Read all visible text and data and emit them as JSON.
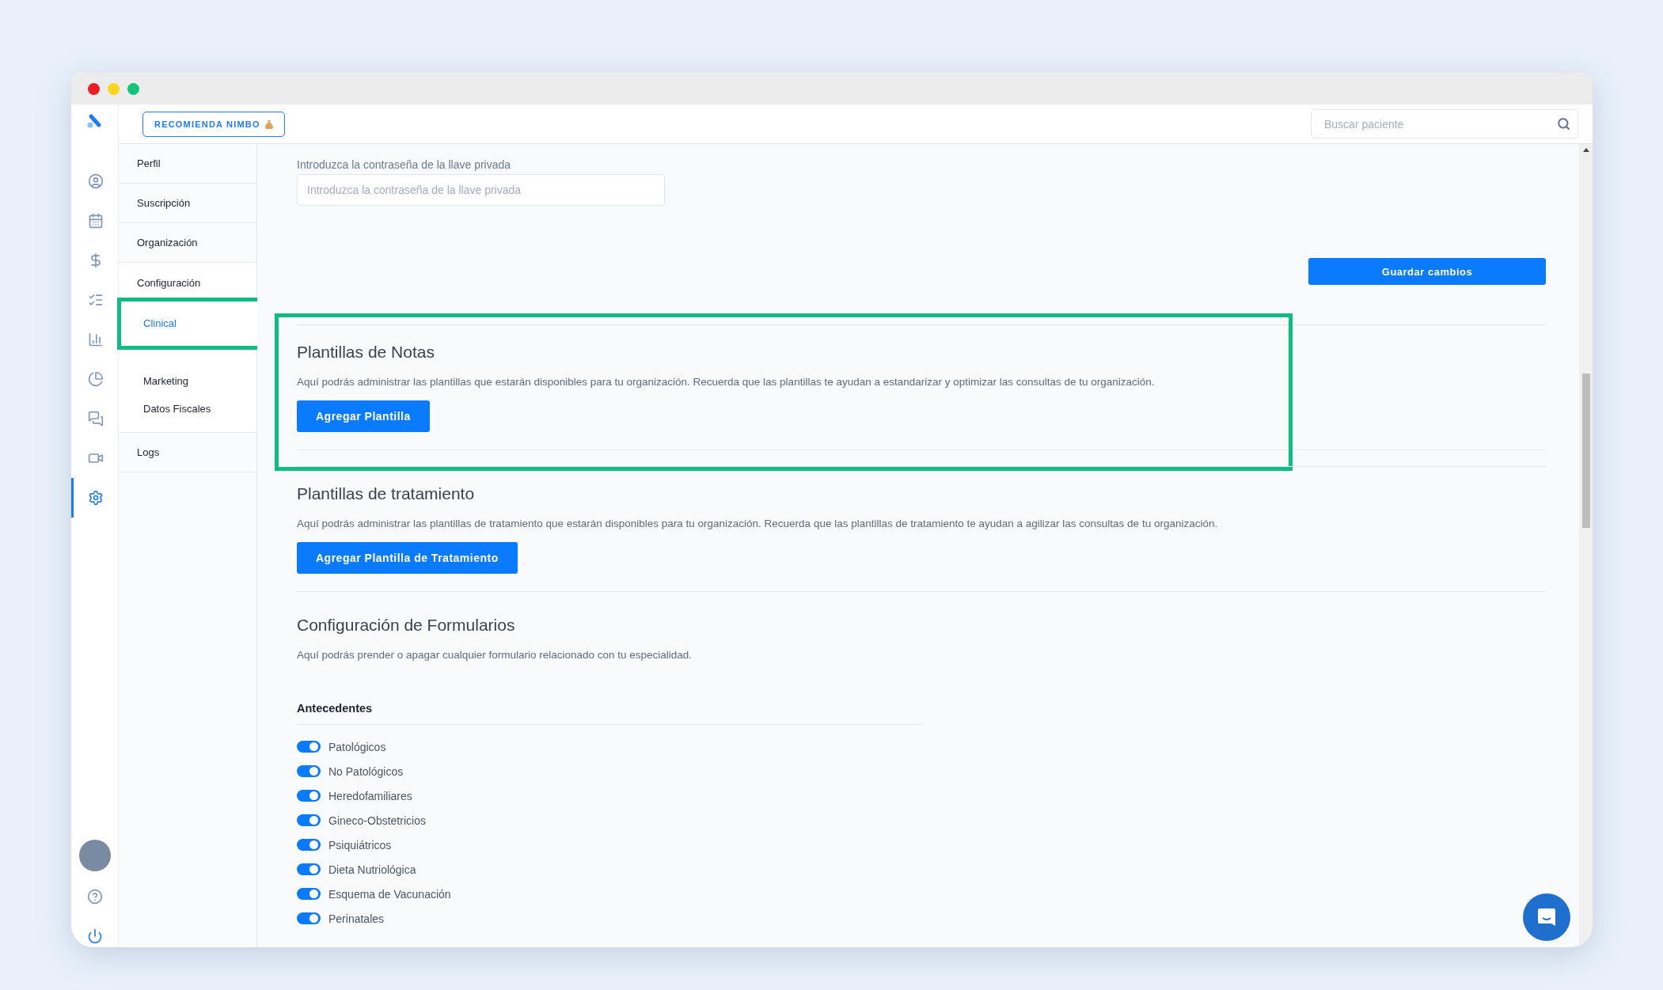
{
  "topbar": {
    "referral_button": "RECOMIENDA NIMBO",
    "search": {
      "placeholder": "Buscar paciente"
    }
  },
  "rail": {
    "items": [
      {
        "kind": "user",
        "selected": false
      },
      {
        "kind": "calendar",
        "selected": false
      },
      {
        "kind": "money",
        "selected": false
      },
      {
        "kind": "list",
        "selected": false
      },
      {
        "kind": "bars",
        "selected": false
      },
      {
        "kind": "gauge",
        "selected": false
      },
      {
        "kind": "chat",
        "selected": false
      },
      {
        "kind": "video",
        "selected": false
      },
      {
        "kind": "settings",
        "selected": true
      }
    ]
  },
  "nav": {
    "items": [
      {
        "label": "Perfil",
        "selected": false
      },
      {
        "label": "Suscripción",
        "selected": false
      },
      {
        "label": "Organización",
        "selected": false
      },
      {
        "label": "Configuración",
        "selected": false,
        "children": [
          {
            "label": "Clinical",
            "selected": true,
            "highlighted": true
          },
          {
            "label": "Marketing",
            "selected": false,
            "highlighted": false
          },
          {
            "label": "Datos Fiscales",
            "selected": false,
            "highlighted": false
          }
        ]
      },
      {
        "label": "Logs",
        "selected": false
      }
    ]
  },
  "certificate": {
    "password_label": "Introduzca la contraseña de la llave privada",
    "password_field": {
      "placeholder": "Introduzca la contraseña de la llave privada"
    },
    "save_button": "Guardar cambios"
  },
  "sections": [
    {
      "title": "Plantillas de Notas",
      "description": "Aquí podrás administrar las plantillas que estarán disponibles para tu organización. Recuerda que las plantillas te ayudan a estandarizar y optimizar las consultas de tu organización.",
      "button": "Agregar Plantilla",
      "highlighted": true
    },
    {
      "title": "Plantillas de tratamiento",
      "description": "Aquí podrás administrar las plantillas de tratamiento que estarán disponibles para tu organización. Recuerda que las plantillas de tratamiento te ayudan a agilizar las consultas de tu organización.",
      "button": "Agregar Plantilla de Tratamiento",
      "highlighted": false
    }
  ],
  "forms": {
    "title": "Configuración de Formularios",
    "description": "Aquí podrás prender o apagar cualquier formulario relacionado con tu especialidad.",
    "group": {
      "title": "Antecedentes",
      "toggles": [
        {
          "label": "Patológicos",
          "on": true
        },
        {
          "label": "No Patológicos",
          "on": true
        },
        {
          "label": "Heredofamiliares",
          "on": true
        },
        {
          "label": "Gineco-Obstetricios",
          "on": true
        },
        {
          "label": "Psiquiátricos",
          "on": true
        },
        {
          "label": "Dieta Nutriológica",
          "on": true
        },
        {
          "label": "Esquema de Vacunación",
          "on": true
        },
        {
          "label": "Perinatales",
          "on": true
        }
      ]
    }
  }
}
